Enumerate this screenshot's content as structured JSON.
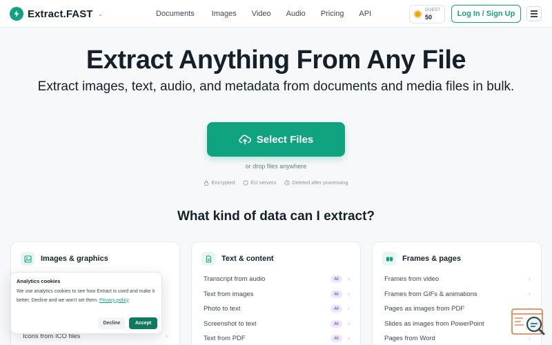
{
  "header": {
    "brand": "Extract.FAST",
    "nav": [
      "Documents",
      "Images",
      "Video",
      "Audio",
      "Pricing",
      "API"
    ],
    "guest_label": "GUEST",
    "guest_credits": "50",
    "login_label": "Log In / Sign Up"
  },
  "hero": {
    "title": "Extract Anything From Any File",
    "subtitle": "Extract images, text, audio, and metadata from documents and media files in bulk.",
    "select_label": "Select Files",
    "drop_text": "or drop files anywhere",
    "trust": [
      "Encrypted",
      "EU servers",
      "Deleted after processing"
    ]
  },
  "section_title": "What kind of data can I extract?",
  "cards": [
    {
      "title": "Images & graphics",
      "items": [],
      "last_item": "Icons from ICO files"
    },
    {
      "title": "Text & content",
      "items": [
        {
          "label": "Transcript from audio",
          "badge": "AI"
        },
        {
          "label": "Text from images",
          "badge": "AI"
        },
        {
          "label": "Photo to text",
          "badge": "AI"
        },
        {
          "label": "Screenshot to text",
          "badge": "AI"
        },
        {
          "label": "Text from PDF",
          "badge": "AI"
        }
      ]
    },
    {
      "title": "Frames & pages",
      "items": [
        {
          "label": "Frames from video",
          "badge": ""
        },
        {
          "label": "Frames from GIFs & animations",
          "badge": ""
        },
        {
          "label": "Pages as images from PDF",
          "badge": ""
        },
        {
          "label": "Slides as images from PowerPoint",
          "badge": ""
        },
        {
          "label": "Pages from Word",
          "badge": ""
        }
      ]
    }
  ],
  "cookie": {
    "title": "Analytics cookies",
    "body": "We use analytics cookies to see how Extract is used and make it better. Decline and we won't set them.",
    "link": "Privacy policy",
    "decline": "Decline",
    "accept": "Accept"
  },
  "colors": {
    "accent": "#10a37f",
    "accept": "#0f7a5f",
    "ai_badge": "#7b4fd6"
  }
}
